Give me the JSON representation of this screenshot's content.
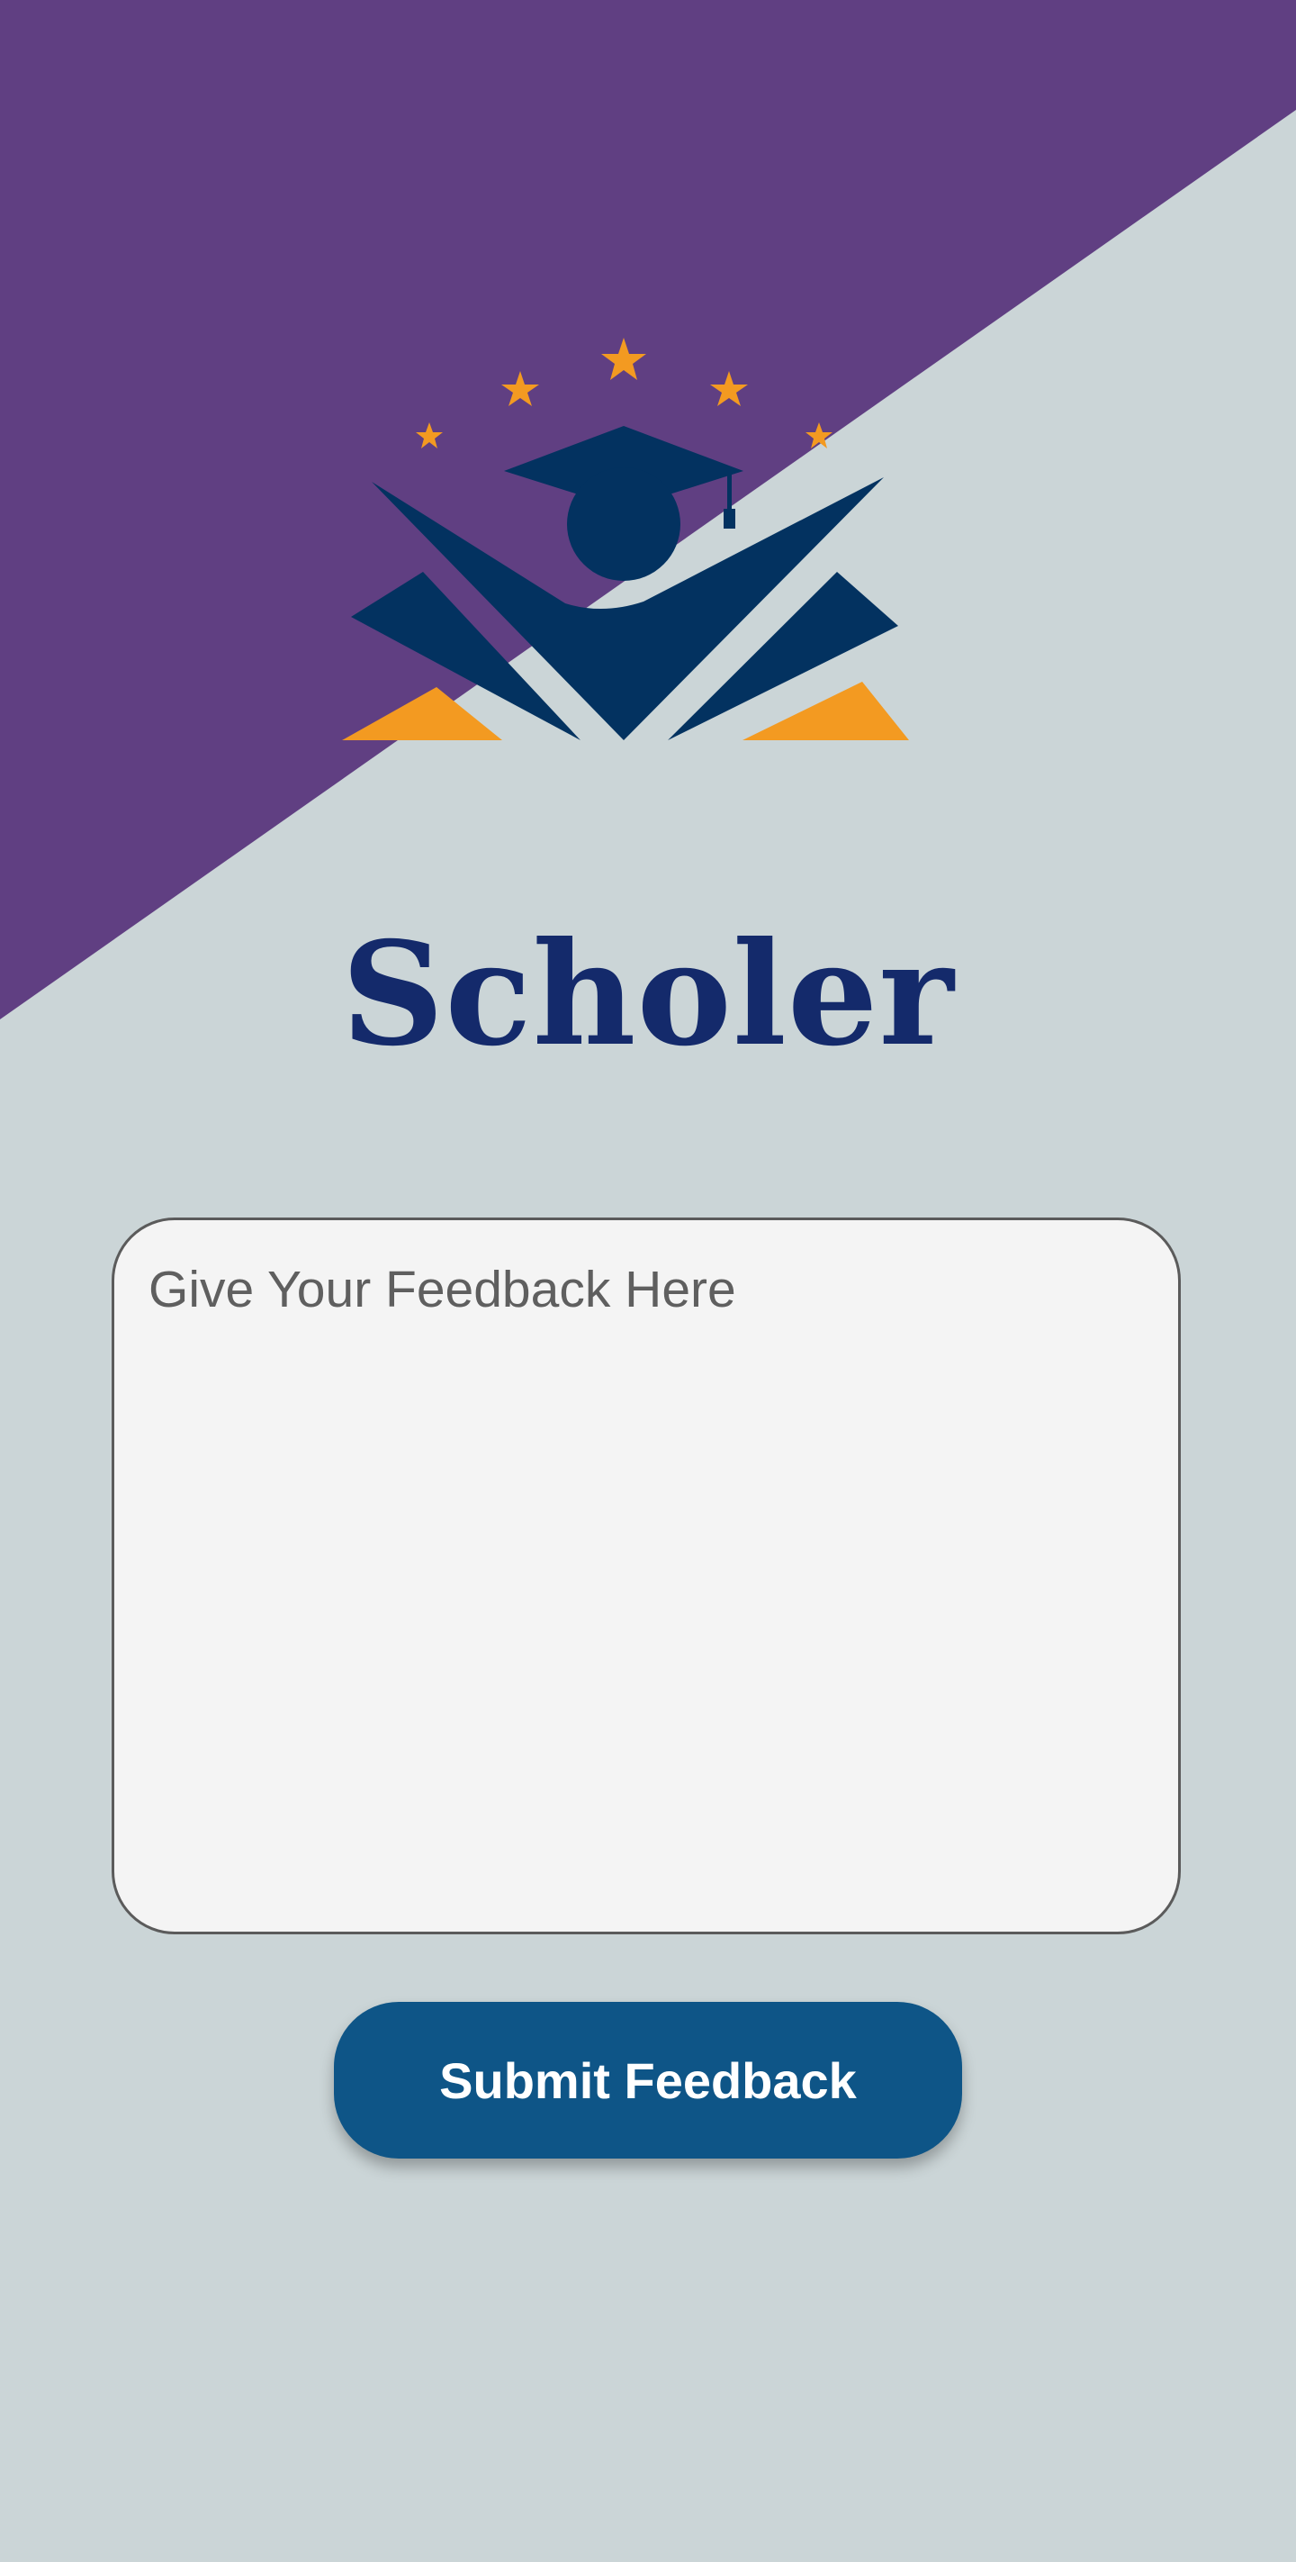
{
  "app": {
    "title": "Scholer"
  },
  "logo": {
    "icon": "graduate-cap-logo-icon",
    "colors": {
      "navy": "#033260",
      "orange": "#f39a21"
    }
  },
  "feedback": {
    "placeholder": "Give Your Feedback Here",
    "value": ""
  },
  "submit": {
    "label": "Submit Feedback"
  },
  "theme": {
    "header_purple": "#603f82",
    "background": "#cbd5d7",
    "title_color": "#142a6b",
    "button_color": "#0e5587"
  }
}
